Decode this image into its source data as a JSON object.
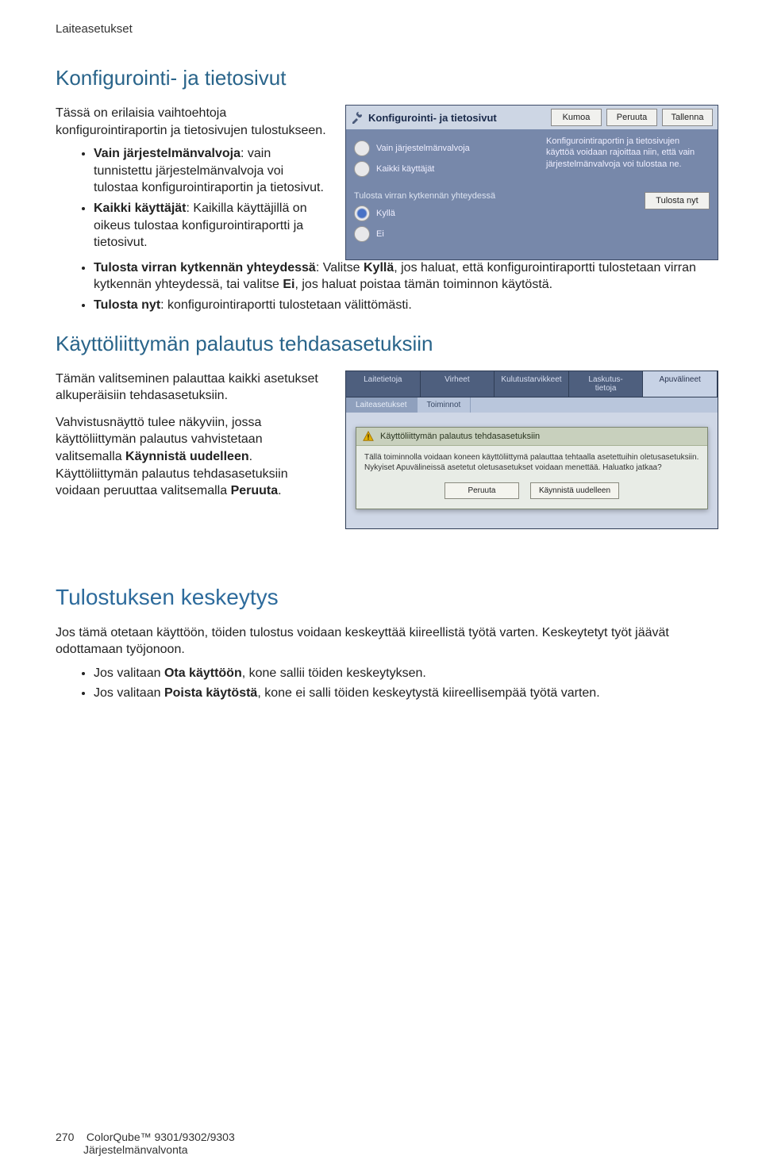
{
  "breadcrumb": "Laiteasetukset",
  "section1": {
    "title": "Konfigurointi- ja tietosivut",
    "intro": "Tässä on erilaisia vaihtoehtoja konfigurointiraportin ja tietosivujen tulostukseen.",
    "bullets": {
      "b1_bold": "Vain järjestelmänvalvoja",
      "b1_rest": ": vain tunnistettu järjestelmänvalvoja voi tulostaa konfigurointiraportin ja tietosivut.",
      "b2_bold": "Kaikki käyttäjät",
      "b2_rest": ": Kaikilla käyttäjillä on oikeus tulostaa konfigurointiraportti ja tietosivut.",
      "b3_bold": "Tulosta virran kytkennän yhteydessä",
      "b3_rest_a": ": Valitse ",
      "b3_kw1": "Kyllä",
      "b3_rest_b": ", jos haluat, että konfigurointiraportti tulostetaan virran kytkennän yhteydessä, tai valitse ",
      "b3_kw2": "Ei",
      "b3_rest_c": ", jos haluat poistaa tämän toiminnon käytöstä.",
      "b4_bold": "Tulosta nyt",
      "b4_rest": ": konfigurointiraportti tulostetaan välittömästi."
    }
  },
  "shot1": {
    "title": "Konfigurointi- ja tietosivut",
    "btn_undo": "Kumoa",
    "btn_cancel": "Peruuta",
    "btn_save": "Tallenna",
    "opt_admin": "Vain järjestelmänvalvoja",
    "opt_all": "Kaikki käyttäjät",
    "subhead": "Tulosta virran kytkennän yhteydessä",
    "opt_yes": "Kyllä",
    "opt_no": "Ei",
    "desc": "Konfigurointiraportin ja tietosivujen käyttöä voidaan rajoittaa niin, että vain järjestelmänvalvoja voi tulostaa ne.",
    "btn_print": "Tulosta nyt"
  },
  "section2": {
    "title": "Käyttöliittymän palautus tehdasasetuksiin",
    "p1": "Tämän valitseminen palauttaa kaikki asetukset alkuperäisiin tehdasasetuksiin.",
    "p2a": "Vahvistusnäyttö tulee näkyviin, jossa käyttöliittymän palautus vahvistetaan valitsemalla ",
    "p2_bold1": "Käynnistä uudelleen",
    "p2b": ". Käyttöliittymän palautus tehdasasetuksiin voidaan peruuttaa valitsemalla ",
    "p2_bold2": "Peruuta",
    "p2c": "."
  },
  "shot2": {
    "tabs": [
      "Laitetietoja",
      "Virheet",
      "Kulutustarvikkeet",
      "Laskutus-\ntietoja",
      "Apuvälineet"
    ],
    "subtabs": [
      "Laiteasetukset",
      "Toiminnot"
    ],
    "dialog_title": "Käyttöliittymän palautus tehdasasetuksiin",
    "dialog_body": "Tällä toiminnolla voidaan koneen käyttöliittymä palauttaa tehtaalla asetettuihin oletusasetuksiin. Nykyiset Apuvälineissä asetetut oletusasetukset voidaan menettää. Haluatko jatkaa?",
    "btn_cancel": "Peruuta",
    "btn_restart": "Käynnistä uudelleen"
  },
  "section3": {
    "title": "Tulostuksen keskeytys",
    "p1": "Jos tämä otetaan käyttöön, töiden tulostus voidaan keskeyttää kiireellistä työtä varten. Keskeytetyt työt jäävät odottamaan työjonoon.",
    "b1a": "Jos valitaan ",
    "b1_bold": "Ota käyttöön",
    "b1b": ", kone sallii töiden keskeytyksen.",
    "b2a": "Jos valitaan ",
    "b2_bold": "Poista käytöstä",
    "b2b": ", kone ei salli töiden keskeytystä kiireellisempää työtä varten."
  },
  "footer": {
    "page": "270",
    "product": "ColorQube™ 9301/9302/9303",
    "doc": "Järjestelmänvalvonta"
  }
}
